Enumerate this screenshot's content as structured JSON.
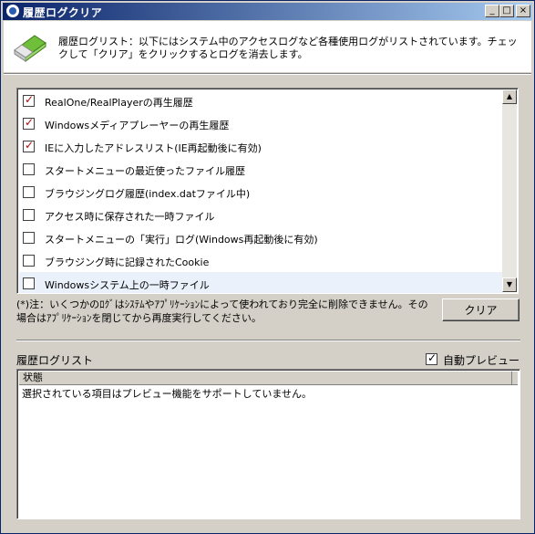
{
  "window": {
    "title": "履歴ログクリア",
    "buttons": {
      "minimize": "_",
      "maximize": "□",
      "close": "×"
    }
  },
  "header": {
    "description": "履歴ログリスト：以下にはシステム中のアクセスログなど各種使用ログがリストされています。チェックして「クリア」をクリックするとログを消去します。"
  },
  "log_list": {
    "items": [
      {
        "label": "RealOne/RealPlayerの再生履歴",
        "checked": true
      },
      {
        "label": "Windowsメディアプレーヤーの再生履歴",
        "checked": true
      },
      {
        "label": "IEに入力したアドレスリスト(IE再起動後に有効)",
        "checked": true
      },
      {
        "label": "スタートメニューの最近使ったファイル履歴",
        "checked": false
      },
      {
        "label": "ブラウジングログ履歴(index.datファイル中)",
        "checked": false
      },
      {
        "label": "アクセス時に保存された一時ファイル",
        "checked": false
      },
      {
        "label": "スタートメニューの「実行」ログ(Windows再起動後に有効)",
        "checked": false
      },
      {
        "label": "ブラウジング時に記録されたCookie",
        "checked": false
      },
      {
        "label": "Windowsシステム上の一時ファイル",
        "checked": false
      }
    ],
    "scroll_up": "▲",
    "scroll_down": "▼"
  },
  "note": "(*)注：いくつかのﾛｸﾞはｼｽﾃﾑやｱﾌﾟﾘｹｰｼｮﾝによって使われており完全に削除できません。その場合はｱﾌﾟﾘｹｰｼｮﾝを閉じてから再度実行してください。",
  "clear_button": "クリア",
  "history_section": {
    "label": "履歴ログリスト",
    "auto_preview": {
      "label": "自動プレビュー",
      "checked": true
    },
    "column_header": "状態",
    "message": "選択されている項目はプレビュー機能をサポートしていません。"
  },
  "colors": {
    "title_gradient_start": "#0a246a",
    "title_gradient_end": "#a6caf0",
    "check_mark": "#c00000",
    "face": "#d4d0c8"
  },
  "icons": {
    "app": "app-icon",
    "header": "eraser-icon",
    "check": "checkmark"
  }
}
